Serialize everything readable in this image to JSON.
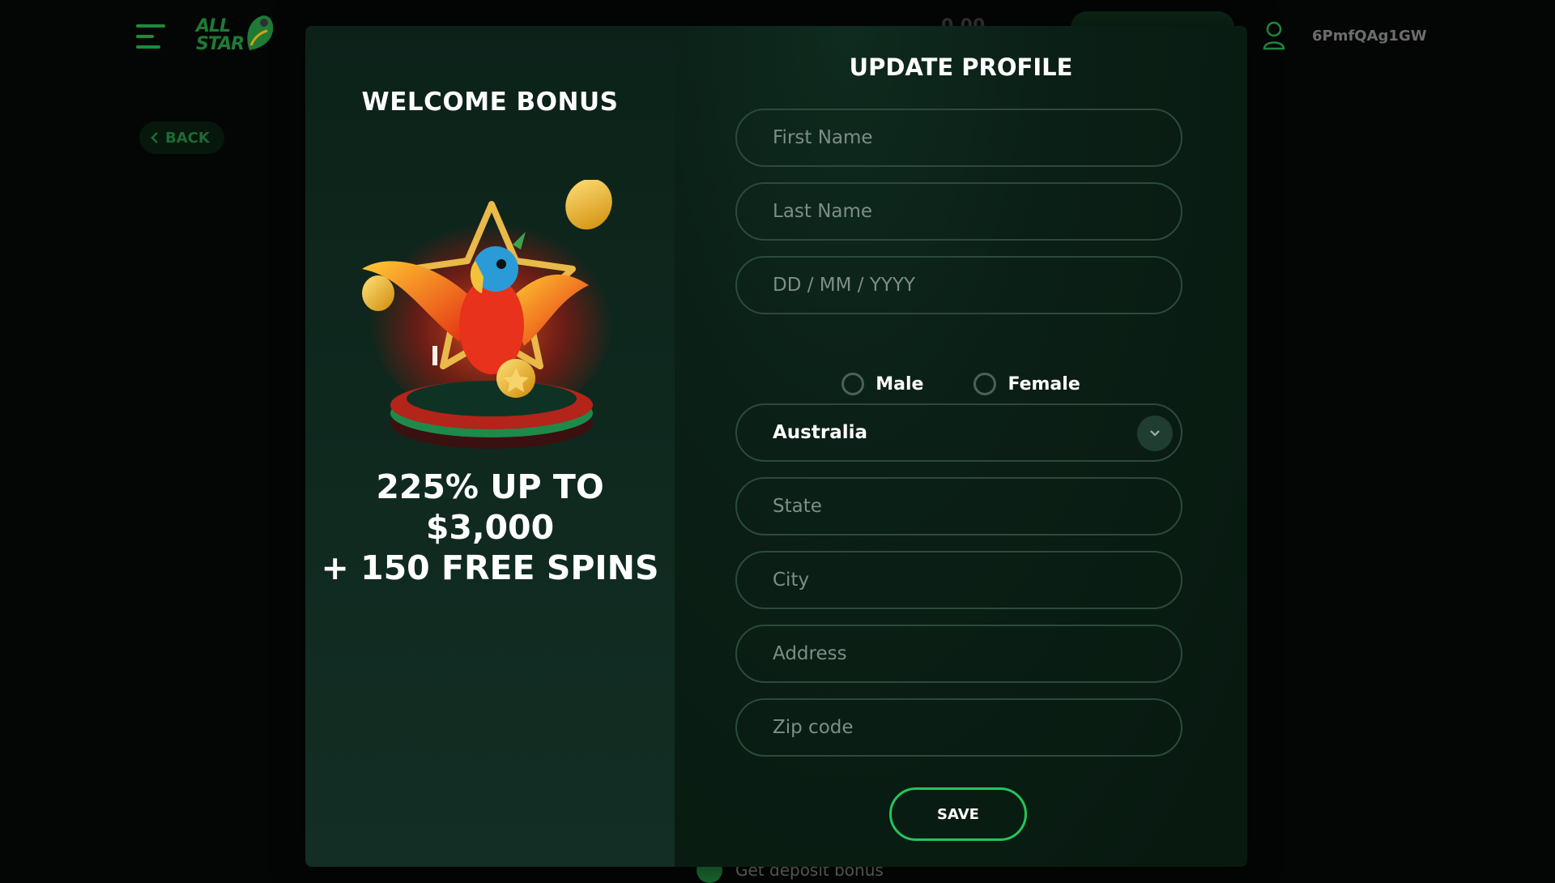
{
  "header": {
    "logo_text": "ALL STAR",
    "balance": "0.00",
    "username": "6PmfQAg1GW"
  },
  "nav": {
    "back_label": "BACK"
  },
  "background": {
    "bottom_text": "Get deposit bonus"
  },
  "bonus": {
    "title": "WELCOME BONUS",
    "line1": "225% UP TO",
    "line2": "$3,000",
    "line3": "+ 150 FREE SPINS"
  },
  "form": {
    "title": "UPDATE PROFILE",
    "first_name_placeholder": "First Name",
    "last_name_placeholder": "Last Name",
    "dob_placeholder": "DD / MM / YYYY",
    "gender_options": [
      "Male",
      "Female"
    ],
    "country_value": "Australia",
    "state_placeholder": "State",
    "city_placeholder": "City",
    "address_placeholder": "Address",
    "zip_placeholder": "Zip code",
    "save_label": "SAVE"
  },
  "icons": {
    "menu": "hamburger-menu-icon",
    "user": "user-icon",
    "back": "chevron-left-icon",
    "select": "chevron-down-icon"
  },
  "colors": {
    "accent": "#22c55e",
    "modal_bg": "#081a12",
    "field_border": "#2c4a3c"
  }
}
